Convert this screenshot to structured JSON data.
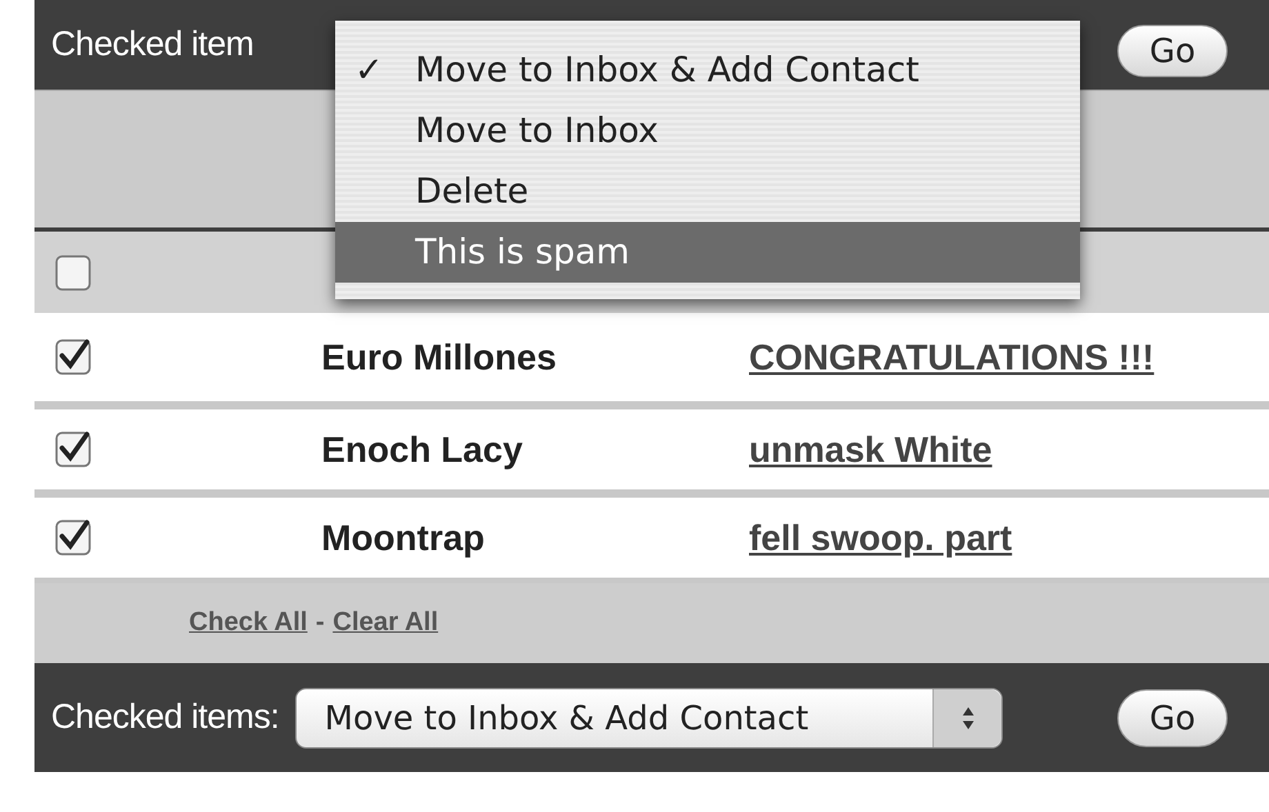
{
  "top_bar": {
    "label": "Checked item",
    "go_button": "Go"
  },
  "action_menu": {
    "items": [
      {
        "label": "Move to Inbox & Add Contact",
        "checked": true,
        "selected": false
      },
      {
        "label": "Move to Inbox",
        "checked": false,
        "selected": false
      },
      {
        "label": "Delete",
        "checked": false,
        "selected": false
      },
      {
        "label": "This is spam",
        "checked": false,
        "selected": true
      }
    ],
    "check_mark": "✓"
  },
  "header_row": {
    "checked": false
  },
  "messages": [
    {
      "checked": true,
      "sender": "Euro Millones",
      "subject": "CONGRATULATIONS !!!"
    },
    {
      "checked": true,
      "sender": "Enoch Lacy",
      "subject": "unmask White"
    },
    {
      "checked": true,
      "sender": "Moontrap",
      "subject": "fell swoop. part"
    }
  ],
  "footer": {
    "links": [
      "Check All",
      "Clear All"
    ],
    "separator": "-"
  },
  "bottom_bar": {
    "label": "Checked items:",
    "select_value": "Move to Inbox & Add Contact",
    "go_button": "Go"
  }
}
